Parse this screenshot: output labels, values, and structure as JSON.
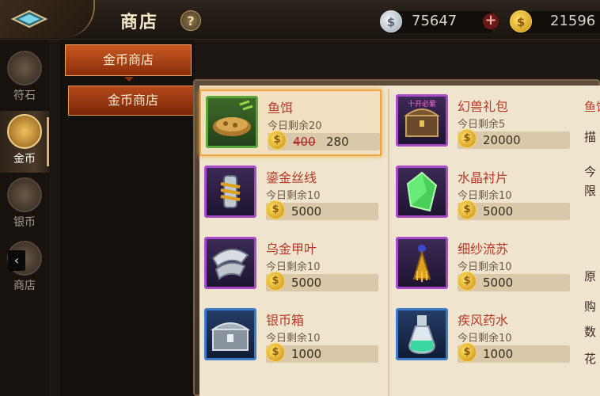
{
  "header": {
    "title": "商店",
    "help_label": "?",
    "silver_value": "75647",
    "plus_label": "+",
    "gold_value": "21596",
    "coin_glyph": "$"
  },
  "left_nav": [
    {
      "label": "符石",
      "icon": "rune-icon",
      "active": false
    },
    {
      "label": "金币",
      "icon": "gold-coin-icon",
      "active": true
    },
    {
      "label": "银币",
      "icon": "silver-coin-icon",
      "active": false
    },
    {
      "label": "商店",
      "icon": "shop-icon",
      "active": false
    }
  ],
  "collapse_arrow": "‹",
  "sub_nav": {
    "header": "金币商店",
    "items": [
      "金币商店"
    ]
  },
  "items": [
    {
      "name": "鱼饵",
      "remain": "今日剩余20",
      "old_price": "400",
      "price": "280",
      "frame": "green",
      "icon": "bait-icon"
    },
    {
      "name": "幻兽礼包",
      "remain": "今日剩余5",
      "price": "20000",
      "frame": "purple",
      "icon": "treasure-chest-icon",
      "badge": "十开必紫"
    },
    {
      "name": "鎏金丝线",
      "remain": "今日剩余10",
      "price": "5000",
      "frame": "purple",
      "icon": "golden-thread-icon"
    },
    {
      "name": "水晶衬片",
      "remain": "今日剩余10",
      "price": "5000",
      "frame": "purple",
      "icon": "crystal-shard-icon"
    },
    {
      "name": "乌金甲叶",
      "remain": "今日剩余10",
      "price": "5000",
      "frame": "purple",
      "icon": "armor-leaf-icon"
    },
    {
      "name": "细纱流苏",
      "remain": "今日剩余10",
      "price": "5000",
      "frame": "purple",
      "icon": "tassel-icon"
    },
    {
      "name": "银币箱",
      "remain": "今日剩余10",
      "price": "1000",
      "frame": "blue",
      "icon": "silver-chest-icon"
    },
    {
      "name": "疾风药水",
      "remain": "今日剩余10",
      "price": "1000",
      "frame": "blue",
      "icon": "potion-icon"
    }
  ],
  "detail_column": {
    "title": "鱼饵",
    "desc": "描",
    "today": "今",
    "limit": "限",
    "orig": "原",
    "buy": "购",
    "qty": "数",
    "cost": "花"
  },
  "colors": {
    "accent_orange": "#c8581e",
    "item_name_red": "#b83a2a",
    "frame_green": "#5aa83a",
    "frame_purple": "#a84ac8",
    "frame_blue": "#3a7ac8",
    "selected_glow": "#f0a640"
  }
}
